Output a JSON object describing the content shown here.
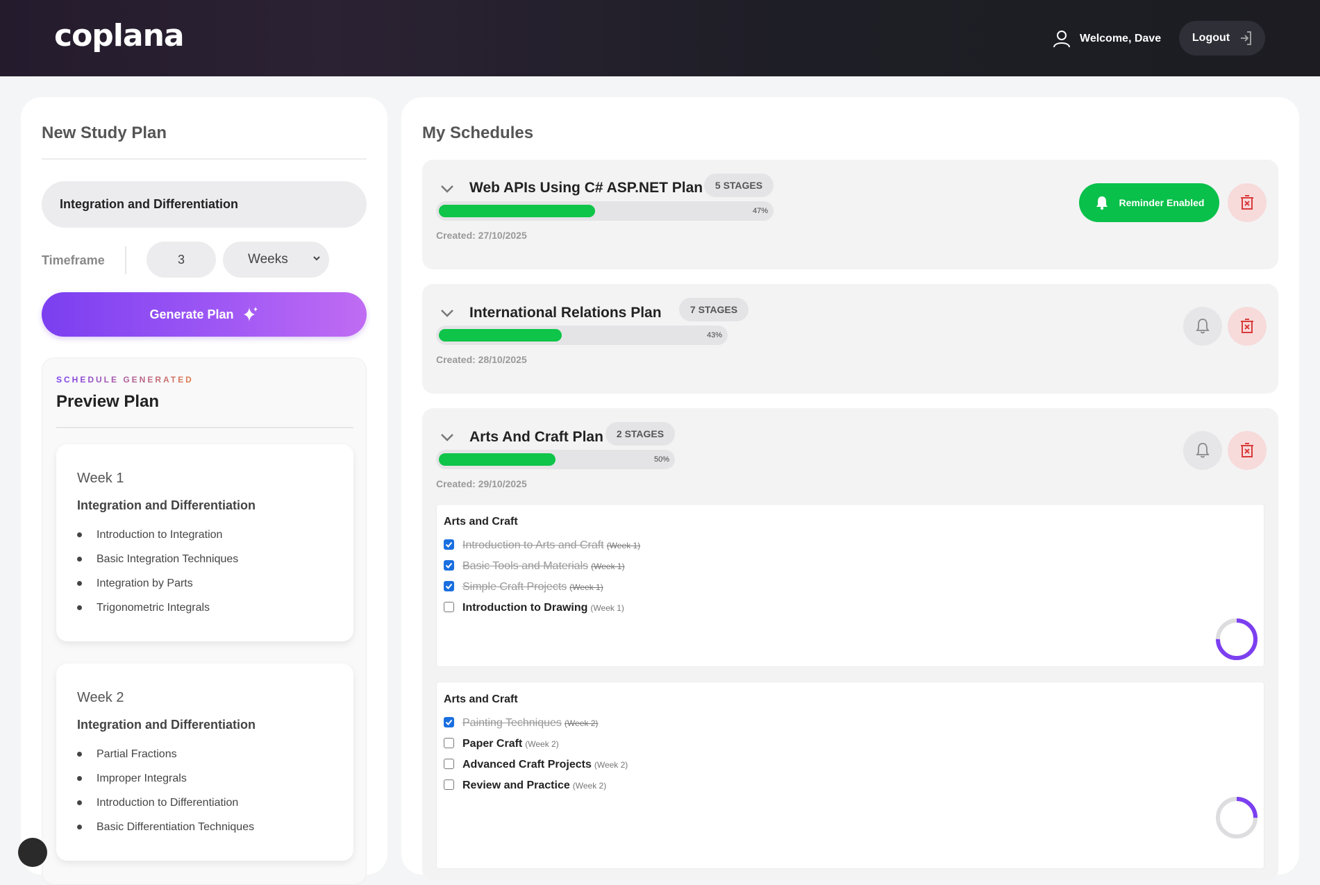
{
  "header": {
    "logo": "coplana",
    "welcome": "Welcome, Dave",
    "logout": "Logout"
  },
  "new_plan": {
    "title": "New Study Plan",
    "topic_value": "Integration and Differentiation",
    "timeframe_label": "Timeframe",
    "timeframe_value": "3",
    "timeframe_unit": "Weeks",
    "generate_label": "Generate Plan"
  },
  "preview": {
    "tag": "SCHEDULE GENERATED",
    "title": "Preview Plan",
    "weeks": [
      {
        "title": "Week 1",
        "subject": "Integration and Differentiation",
        "topics": [
          "Introduction to Integration",
          "Basic Integration Techniques",
          "Integration by Parts",
          "Trigonometric Integrals"
        ]
      },
      {
        "title": "Week 2",
        "subject": "Integration and Differentiation",
        "topics": [
          "Partial Fractions",
          "Improper Integrals",
          "Introduction to Differentiation",
          "Basic Differentiation Techniques"
        ]
      }
    ]
  },
  "schedules": {
    "title": "My Schedules",
    "items": [
      {
        "name": "Web APIs Using C# ASP.NET Plan",
        "stages": "5 STAGES",
        "progress": 47,
        "progress_label": "47%",
        "created": "Created: 27/10/2025",
        "reminder_label": "Reminder Enabled"
      },
      {
        "name": "International Relations Plan",
        "stages": "7 STAGES",
        "progress": 43,
        "progress_label": "43%",
        "created": "Created: 28/10/2025"
      },
      {
        "name": "Arts And Craft Plan",
        "stages": "2 STAGES",
        "progress": 50,
        "progress_label": "50%",
        "created": "Created: 29/10/2025",
        "stage_groups": [
          {
            "heading": "Arts and Craft",
            "completion": 0.75,
            "tasks": [
              {
                "name": "Introduction to Arts and Craft",
                "week": "(Week 1)",
                "done": true
              },
              {
                "name": "Basic Tools and Materials",
                "week": "(Week 1)",
                "done": true
              },
              {
                "name": "Simple Craft Projects",
                "week": "(Week 1)",
                "done": true
              },
              {
                "name": "Introduction to Drawing",
                "week": "(Week 1)",
                "done": false
              }
            ]
          },
          {
            "heading": "Arts and Craft",
            "completion": 0.25,
            "tasks": [
              {
                "name": "Painting Techniques",
                "week": "(Week 2)",
                "done": true
              },
              {
                "name": "Paper Craft",
                "week": "(Week 2)",
                "done": false
              },
              {
                "name": "Advanced Craft Projects",
                "week": "(Week 2)",
                "done": false
              },
              {
                "name": "Review and Practice",
                "week": "(Week 2)",
                "done": false
              }
            ]
          }
        ]
      }
    ]
  },
  "colors": {
    "accent_purple": "#7b3ff0",
    "success_green": "#0ec449",
    "danger_red": "#d93a3a"
  }
}
